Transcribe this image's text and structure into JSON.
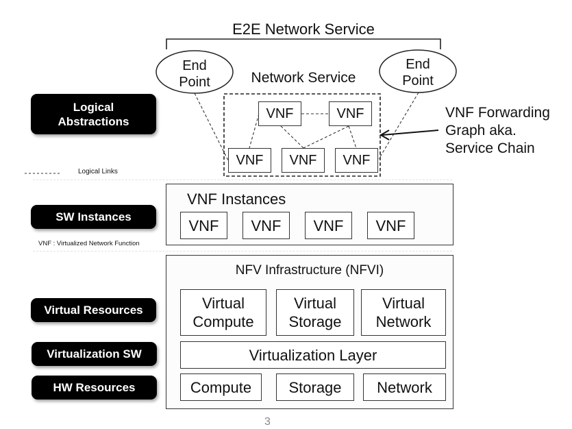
{
  "top": {
    "e2e_title": "E2E Network Service",
    "network_service_title": "Network Service",
    "endpoint_left": "End\nPoint",
    "endpoint_right": "End\nPoint",
    "forwarding_graph_annotation": "VNF Forwarding\nGraph aka.\nService Chain",
    "graph_vnfs": [
      "VNF",
      "VNF",
      "VNF",
      "VNF",
      "VNF"
    ]
  },
  "legend": {
    "logical_links": "Logical Links",
    "vnf_definition": "VNF : Virtualized Network Function"
  },
  "layer_labels": [
    "Logical\nAbstractions",
    "SW Instances",
    "Virtual Resources",
    "Virtualization SW",
    "HW Resources"
  ],
  "vnf_instances": {
    "title": "VNF Instances",
    "items": [
      "VNF",
      "VNF",
      "VNF",
      "VNF"
    ]
  },
  "nfvi": {
    "title": "NFV Infrastructure (NFVI)",
    "virtual_resources": [
      "Virtual\nCompute",
      "Virtual\nStorage",
      "Virtual\nNetwork"
    ],
    "virtualization_layer": "Virtualization Layer",
    "hw_resources": [
      "Compute",
      "Storage",
      "Network"
    ]
  },
  "footer": {
    "page_number": "3"
  }
}
